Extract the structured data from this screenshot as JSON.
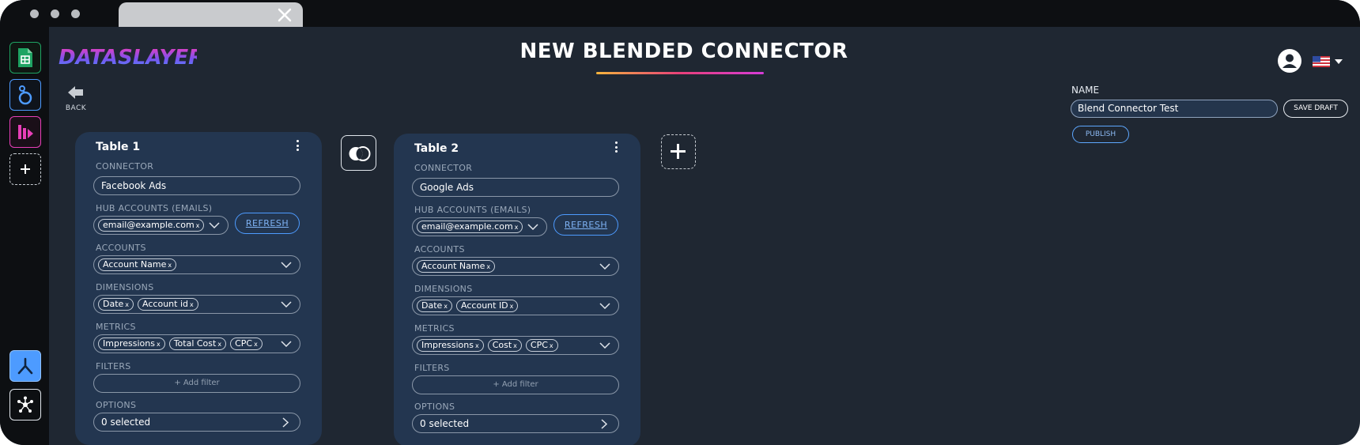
{
  "app": {
    "logo_text": "DATASLAYER",
    "page_title": "NEW BLENDED CONNECTOR",
    "back_label": "BACK"
  },
  "form": {
    "name_label": "NAME",
    "name_value": "Blend Connector Test",
    "save_draft_label": "SAVE DRAFT",
    "publish_label": "PUBLISH"
  },
  "labels": {
    "connector": "CONNECTOR",
    "hub_accounts": "HUB ACCOUNTS (EMAILS)",
    "accounts": "ACCOUNTS",
    "dimensions": "DIMENSIONS",
    "metrics": "METRICS",
    "filters": "FILTERS",
    "options": "OPTIONS",
    "refresh": "REFRESH",
    "add_filter": "+ Add filter"
  },
  "tables": [
    {
      "title": "Table 1",
      "connector": "Facebook Ads",
      "hub_account": "email@example.com",
      "account": "Account Name",
      "dimensions": [
        "Date",
        "Account id"
      ],
      "metrics": [
        "Impressions",
        "Total Cost",
        "CPC"
      ],
      "options": "0 selected"
    },
    {
      "title": "Table 2",
      "connector": "Google Ads",
      "hub_account": "email@example.com",
      "account": "Account Name",
      "dimensions": [
        "Date",
        "Account ID"
      ],
      "metrics": [
        "Impressions",
        "Cost",
        "CPC"
      ],
      "options": "0 selected"
    }
  ],
  "chip_remove_glyph": "x",
  "colors": {
    "background": "#1f2732",
    "card": "#233650",
    "accent_blue": "#4d9bff",
    "sheets_green": "#1fa463",
    "pink": "#e83fb8"
  }
}
